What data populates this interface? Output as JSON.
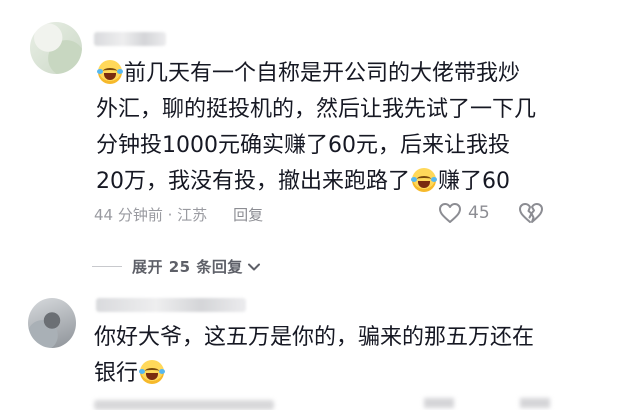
{
  "comment1": {
    "text_part1": "前几天有一个自称是开公司的大佬带我炒外汇，聊的挺投机的，然后让我先试了一下几分钟投1000元确实赚了60元，后来让我投20万，我没有投，撤出来跑路了",
    "text_part2": "赚了60",
    "time_location": "44 分钟前 · 江苏",
    "reply_label": "回复",
    "like_count": "45"
  },
  "expand": {
    "label": "展开 25 条回复"
  },
  "comment2": {
    "text_part1": "你好大爷，这五万是你的，骗来的那五万还在银行"
  },
  "icons": {
    "emoji": "laughing-crying-emoji-icon",
    "like": "heart-outline-icon",
    "dislike": "broken-heart-outline-icon",
    "chevron": "chevron-down-icon"
  }
}
